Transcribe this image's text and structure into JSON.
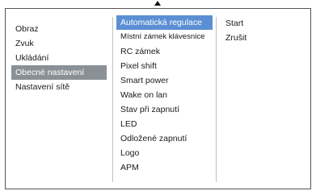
{
  "left_menu": {
    "items": [
      {
        "label": "Obraz",
        "selected": false
      },
      {
        "label": "Zvuk",
        "selected": false
      },
      {
        "label": "Ukládání",
        "selected": false
      },
      {
        "label": "Obecné nastavení",
        "selected": true
      },
      {
        "label": "Nastavení sítě",
        "selected": false
      }
    ]
  },
  "sub_menu": {
    "items": [
      {
        "label": "Automatická regulace",
        "selected": true
      },
      {
        "label": "Místní zámek klávesnice",
        "selected": false
      },
      {
        "label": "RC zámek",
        "selected": false
      },
      {
        "label": "Pixel shift",
        "selected": false
      },
      {
        "label": "Smart power",
        "selected": false
      },
      {
        "label": "Wake on lan",
        "selected": false
      },
      {
        "label": "Stav při zapnutí",
        "selected": false
      },
      {
        "label": "LED",
        "selected": false
      },
      {
        "label": "Odložené zapnutí",
        "selected": false
      },
      {
        "label": "Logo",
        "selected": false
      },
      {
        "label": "APM",
        "selected": false
      }
    ]
  },
  "options": {
    "items": [
      {
        "label": "Start"
      },
      {
        "label": "Zrušit"
      }
    ]
  },
  "colors": {
    "left_selected_bg": "#8a9196",
    "sub_selected_bg": "#5b8fd4",
    "border": "#555555"
  }
}
